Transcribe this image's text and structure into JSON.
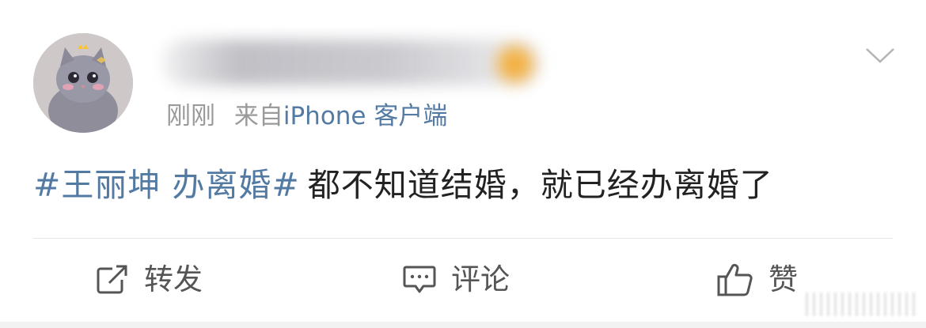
{
  "post": {
    "time": "刚刚",
    "from_label": "来自",
    "source": "iPhone 客户端",
    "topic": "#王丽坤 办离婚#",
    "text": "都不知道结婚，就已经办离婚了"
  },
  "actions": {
    "repost": "转发",
    "comment": "评论",
    "like": "赞"
  },
  "colors": {
    "link": "#537aa3",
    "text": "#222222",
    "meta": "#9a9a9a",
    "action": "#555555",
    "badge": "#f5a623"
  },
  "icons": {
    "menu": "chevron-down-icon",
    "repost": "share-icon",
    "comment": "comment-icon",
    "like": "thumbs-up-icon"
  }
}
